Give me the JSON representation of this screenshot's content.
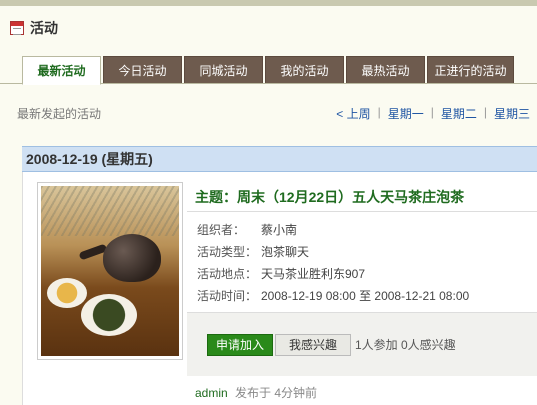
{
  "header": {
    "title": "活动"
  },
  "tabs": [
    {
      "label": "最新活动",
      "active": true
    },
    {
      "label": "今日活动"
    },
    {
      "label": "同城活动"
    },
    {
      "label": "我的活动"
    },
    {
      "label": "最热活动"
    },
    {
      "label": "正进行的活动"
    }
  ],
  "subheader": "最新发起的活动",
  "week_nav": {
    "prev": "< 上周",
    "mon": "星期一",
    "tue": "星期二",
    "wed": "星期三"
  },
  "date_heading": "2008-12-19 (星期五)",
  "event": {
    "title": "主题：周末（12月22日）五人天马茶庄泡茶",
    "organizer_label": "组织者：",
    "organizer": "蔡小南",
    "type_label": "活动类型：",
    "type": "泡茶聊天",
    "place_label": "活动地点：",
    "place": "天马茶业胜利东907",
    "time_label": "活动时间：",
    "time": "2008-12-19 08:00 至 2008-12-21 08:00",
    "join_label": "申请加入",
    "interest_label": "我感兴趣",
    "counts": "1人参加 0人感兴趣",
    "poster": "admin",
    "posted": "发布于  4分钟前"
  },
  "colors": {
    "tab_bg": "#6e5b4e",
    "accent_green": "#1f6b1f",
    "date_bar": "#cfe0f3"
  }
}
